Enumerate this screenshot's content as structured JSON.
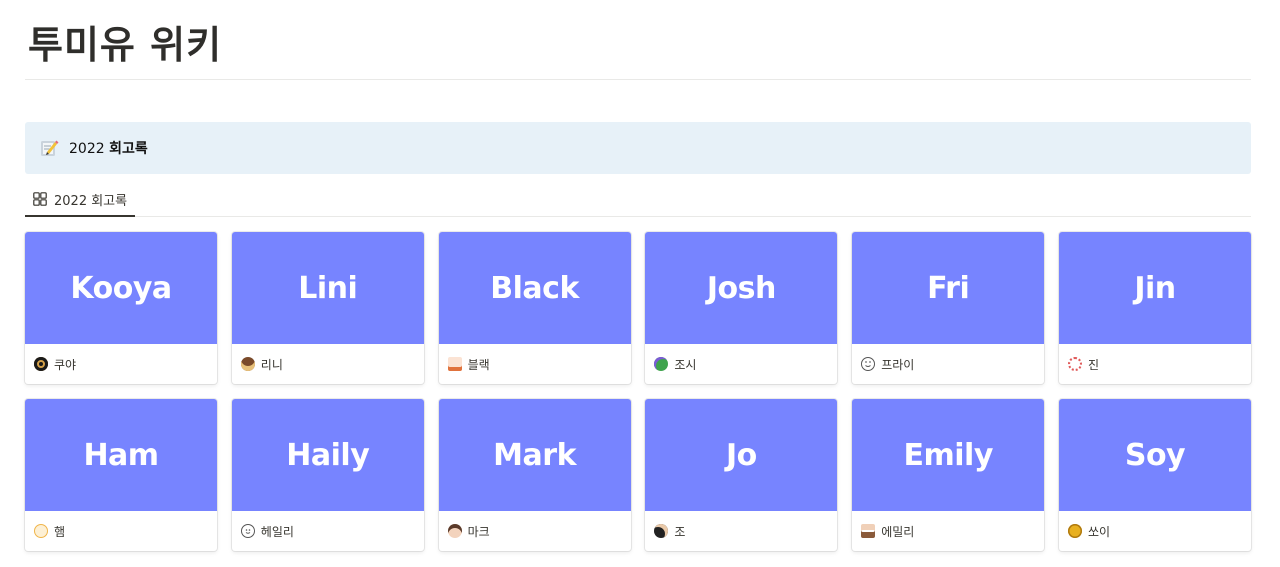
{
  "page": {
    "title": "투미유 위키"
  },
  "callout": {
    "year": "2022",
    "label": "회고록"
  },
  "tabs": [
    {
      "label": "2022 회고록"
    }
  ],
  "cards": [
    {
      "cover_text": "Kooya",
      "name": "쿠야",
      "icon": "black-ring-avatar-icon",
      "icon_color": "#1a1a1a"
    },
    {
      "cover_text": "Lini",
      "name": "리니",
      "icon": "character-avatar-icon",
      "icon_color": "#7a4a2a"
    },
    {
      "cover_text": "Black",
      "name": "블랙",
      "icon": "swimmer-avatar-icon",
      "icon_color": "#e0723c"
    },
    {
      "cover_text": "Josh",
      "name": "조시",
      "icon": "green-globe-avatar-icon",
      "icon_color": "#3fa34d"
    },
    {
      "cover_text": "Fri",
      "name": "프라이",
      "icon": "smiley-avatar-icon",
      "icon_color": "#555555"
    },
    {
      "cover_text": "Jin",
      "name": "진",
      "icon": "flower-avatar-icon",
      "icon_color": "#e05a5a"
    },
    {
      "cover_text": "Ham",
      "name": "햄",
      "icon": "hamster-avatar-icon",
      "icon_color": "#f0b54a"
    },
    {
      "cover_text": "Haily",
      "name": "헤일리",
      "icon": "outline-face-avatar-icon",
      "icon_color": "#555555"
    },
    {
      "cover_text": "Mark",
      "name": "마크",
      "icon": "face-avatar-icon",
      "icon_color": "#c07a5a"
    },
    {
      "cover_text": "Jo",
      "name": "조",
      "icon": "dark-face-avatar-icon",
      "icon_color": "#222222"
    },
    {
      "cover_text": "Emily",
      "name": "에밀리",
      "icon": "figure-avatar-icon",
      "icon_color": "#8a5a3a"
    },
    {
      "cover_text": "Soy",
      "name": "쏘이",
      "icon": "yellow-face-avatar-icon",
      "icon_color": "#e8b020"
    }
  ]
}
